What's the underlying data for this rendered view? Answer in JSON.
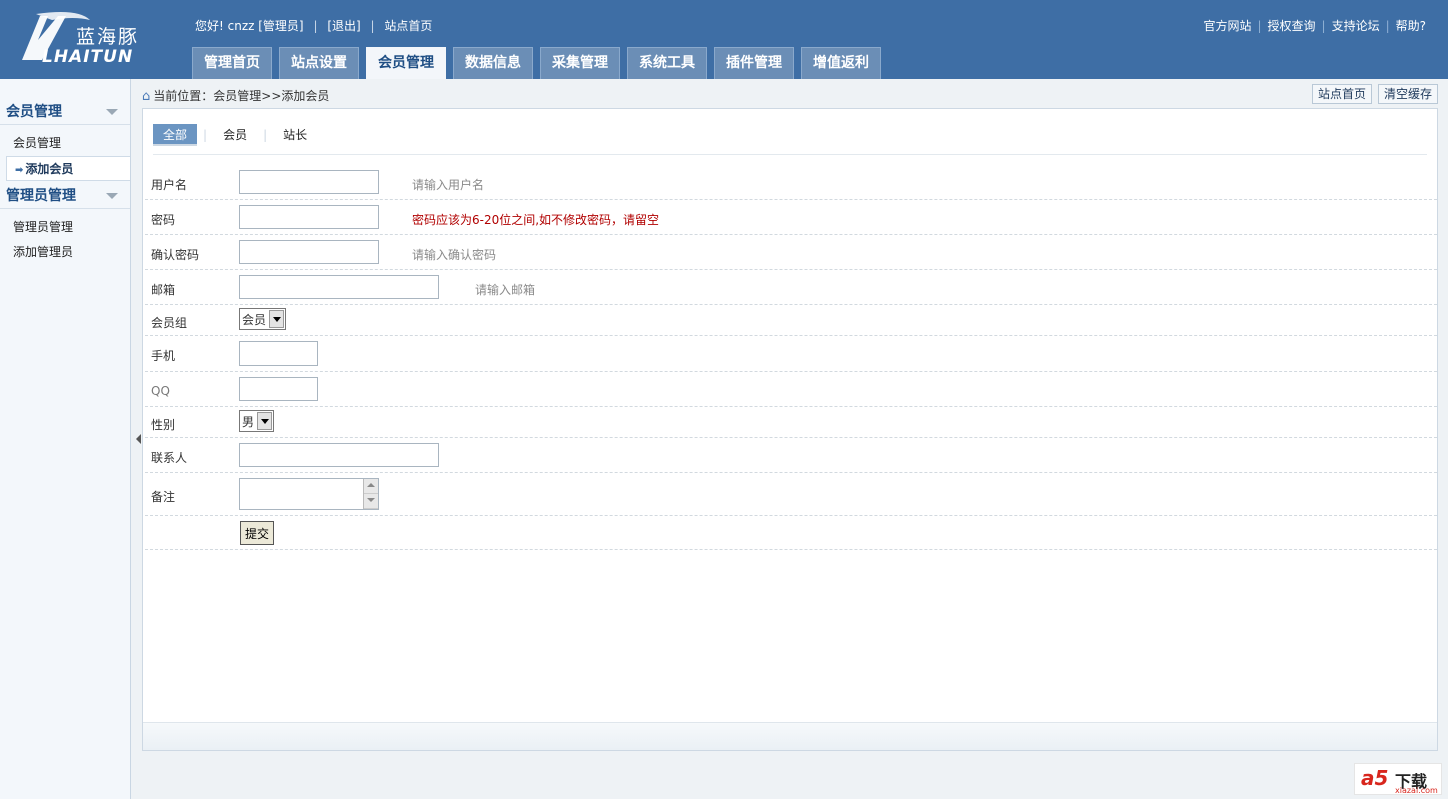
{
  "header": {
    "logo_cn": "蓝海豚",
    "logo_en": "LHAITUN",
    "greeting": "您好! cnzz [管理员]",
    "logout": "[退出]",
    "site_home": "站点首页",
    "right_links": [
      "官方网站",
      "授权查询",
      "支持论坛",
      "帮助?"
    ]
  },
  "nav": {
    "tabs": [
      "管理首页",
      "站点设置",
      "会员管理",
      "数据信息",
      "采集管理",
      "系统工具",
      "插件管理",
      "增值返利"
    ],
    "active_index": 2
  },
  "sidebar": {
    "groups": [
      {
        "title": "会员管理",
        "items": [
          "会员管理",
          "添加会员"
        ]
      },
      {
        "title": "管理员管理",
        "items": [
          "管理员管理",
          "添加管理员"
        ]
      }
    ],
    "active_item": "添加会员"
  },
  "breadcrumb": {
    "text": "当前位置：会员管理>>添加会员"
  },
  "top_buttons": [
    "站点首页",
    "清空缓存"
  ],
  "subtabs": [
    "全部",
    "会员",
    "站长"
  ],
  "form": {
    "username": {
      "label": "用户名",
      "value": "",
      "hint": "请输入用户名"
    },
    "password": {
      "label": "密码",
      "value": "",
      "hint": "密码应该为6-20位之间,如不修改密码，请留空"
    },
    "confirm": {
      "label": "确认密码",
      "value": "",
      "hint": "请输入确认密码"
    },
    "email": {
      "label": "邮箱",
      "value": "",
      "hint": "请输入邮箱"
    },
    "group": {
      "label": "会员组",
      "value": "会员"
    },
    "phone": {
      "label": "手机",
      "value": ""
    },
    "qq": {
      "label": "QQ",
      "value": ""
    },
    "gender": {
      "label": "性别",
      "value": "男"
    },
    "contact": {
      "label": "联系人",
      "value": ""
    },
    "remark": {
      "label": "备注",
      "value": ""
    },
    "submit": "提交"
  },
  "watermark": {
    "brand": "a5",
    "text": "下载",
    "url": "xiazai.com"
  },
  "colors": {
    "header": "#3e6ea5",
    "accent": "#1f4e84",
    "warning": "#b10000"
  }
}
